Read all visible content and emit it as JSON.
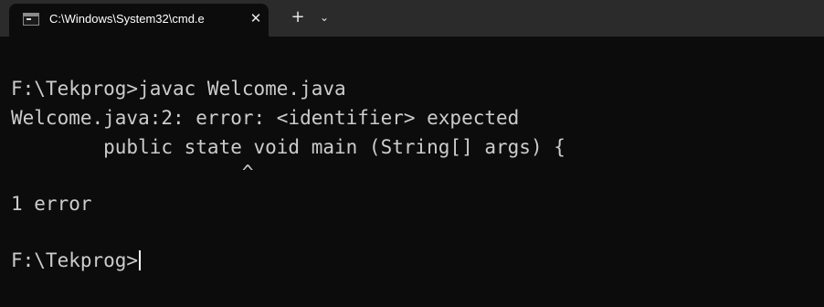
{
  "tab": {
    "icon": "terminal-icon",
    "title": "C:\\Windows\\System32\\cmd.e",
    "close": "✕"
  },
  "new_tab": "+",
  "dropdown": "⌄",
  "terminal": {
    "lines": [
      "F:\\Tekprog>javac Welcome.java",
      "Welcome.java:2: error: <identifier> expected",
      "        public state void main (String[] args) {",
      "                    ^",
      "1 error",
      "F:\\Tekprog>"
    ],
    "text_color": "#cccccc",
    "background": "#0c0c0c"
  }
}
